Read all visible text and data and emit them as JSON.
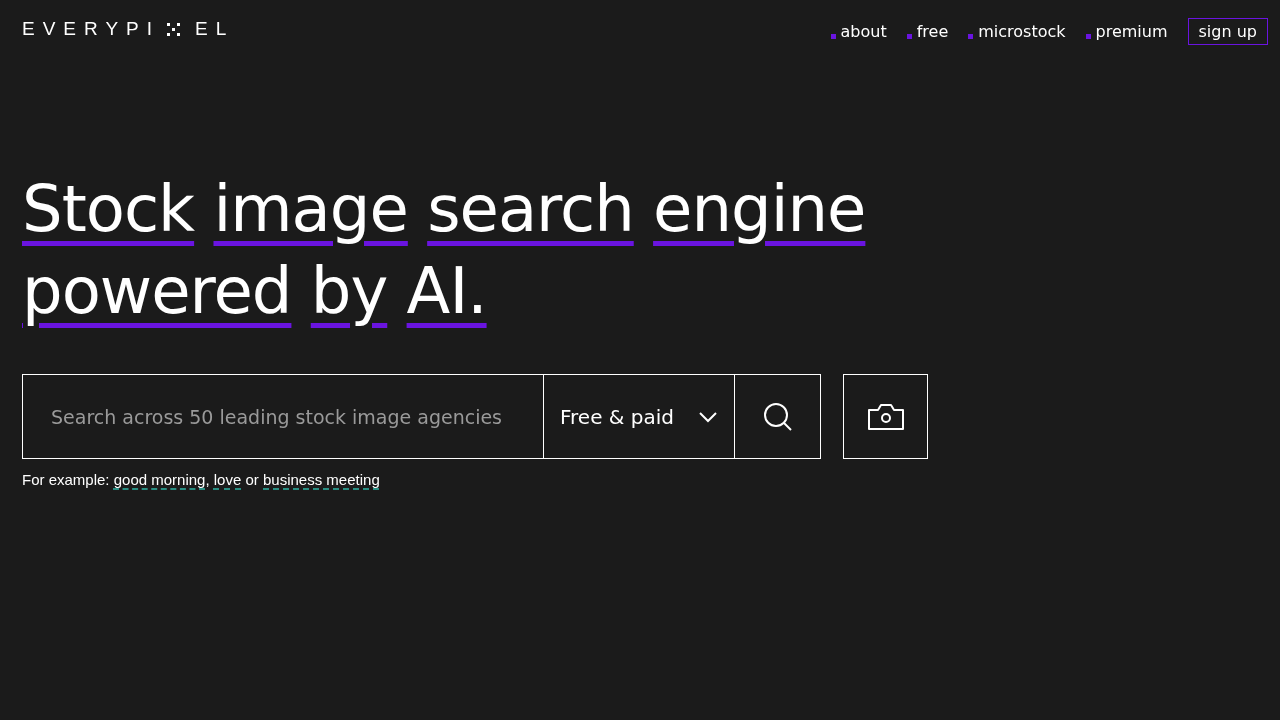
{
  "logo": {
    "before": "EVERYPI",
    "after": "EL"
  },
  "nav": [
    {
      "label": "about"
    },
    {
      "label": "free"
    },
    {
      "label": "microstock"
    },
    {
      "label": "premium"
    }
  ],
  "signup": "sign up",
  "headline": [
    [
      "Stock",
      "image",
      "search",
      "engine"
    ],
    [
      "powered",
      "by",
      "AI."
    ]
  ],
  "search": {
    "placeholder": "Search across 50 leading stock image agencies",
    "filter": "Free & paid"
  },
  "examples": [
    {
      "kind": "text",
      "text": "For example: "
    },
    {
      "kind": "link",
      "text": "good morning"
    },
    {
      "kind": "text",
      "text": ", "
    },
    {
      "kind": "link",
      "text": "love"
    },
    {
      "kind": "text",
      "text": " or "
    },
    {
      "kind": "link",
      "text": "business meeting"
    }
  ]
}
